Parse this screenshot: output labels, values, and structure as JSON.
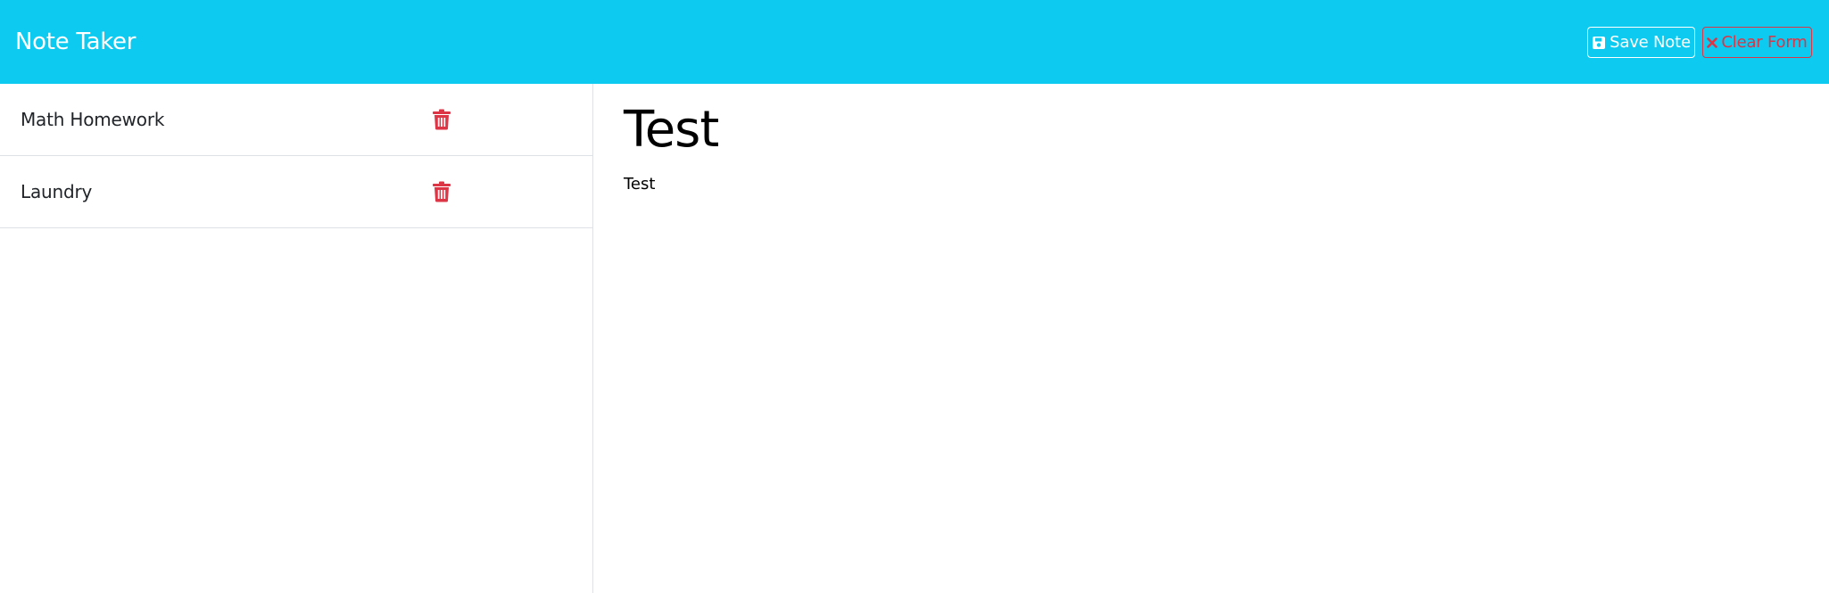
{
  "app": {
    "title": "Note Taker"
  },
  "toolbar": {
    "save_label": "Save Note",
    "clear_label": "Clear Form",
    "save_icon": "floppy-disk-icon",
    "clear_icon": "x-icon"
  },
  "notes": [
    {
      "title": "Math Homework",
      "delete_icon": "trash-icon"
    },
    {
      "title": "Laundry",
      "delete_icon": "trash-icon"
    }
  ],
  "active_note": {
    "title": "Test",
    "text": "Test"
  },
  "colors": {
    "navbar": "#0dcaf0",
    "danger": "#dc3545",
    "border": "#dee2e6"
  }
}
